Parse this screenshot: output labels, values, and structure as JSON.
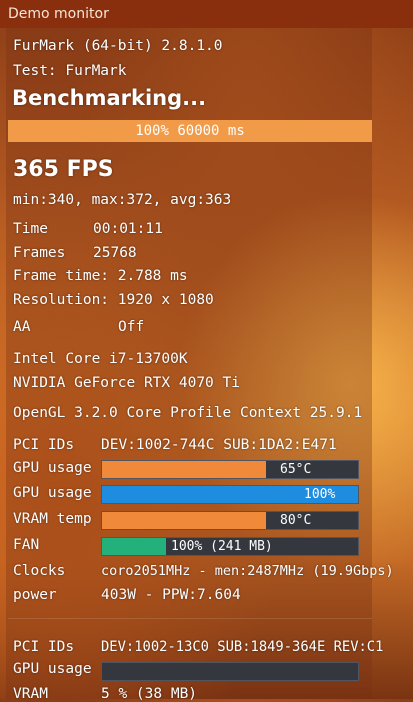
{
  "window": {
    "title": "Demo monitor"
  },
  "app": {
    "name_version": "FurMark (64-bit)  2.8.1.0",
    "test": "Test: FurMark",
    "status": "Benchmarking..."
  },
  "progress": {
    "percent_value": 100,
    "text": "100%  60000 ms"
  },
  "stats": {
    "fps": "365 FPS",
    "minmaxavg": "min:340, max:372, avg:363",
    "time_label": "Time",
    "time_value": "00:01:11",
    "frames_label": "Frames",
    "frames_value": "25768",
    "frametime": "Frame time: 2.788 ms",
    "resolution": "Resolution: 1920 x 1080",
    "aa_label": "AA",
    "aa_value": "Off"
  },
  "system": {
    "cpu": "Intel Core i7-13700K",
    "gpu": "NVIDIA GeForce RTX 4070 Ti",
    "opengl": "OpenGL 3.2.0 Core Profile Context 25.9.1"
  },
  "gpu1": {
    "pci_label": "PCI IDs",
    "pci_value": "DEV:1002-744C SUB:1DA2:E471",
    "temp_label": "GPU usage",
    "temp_text": "65°C",
    "temp_level": 0.64,
    "usage_label": "GPU usage",
    "usage_text": "100%",
    "usage_level": 1.0,
    "vram_label": "VRAM temp",
    "vram_text": "80°C",
    "vram_level": 0.64,
    "fan_label": "FAN",
    "fan_text": "100% (241  MB)",
    "fan_level": 0.25,
    "clocks_label": "Clocks",
    "clocks_value": "coro2051MHz - men:2487MHz (19.9Gbps)",
    "power_label": "power",
    "power_value": "403W - PPW:7.604"
  },
  "gpu2": {
    "pci_label": "PCI IDs",
    "pci_value": "DEV:1002-13C0 SUB:1849-364E REV:C1",
    "usage_label": "GPU usage",
    "usage_level": 0.0,
    "vram_label": "VRAM",
    "vram_value": "5 % (38 MB)"
  },
  "colors": {
    "bar_orange": "#f08a3a",
    "bar_blue": "#1e8de0",
    "bar_green": "#23b07a",
    "bar_track": "#34373d"
  }
}
